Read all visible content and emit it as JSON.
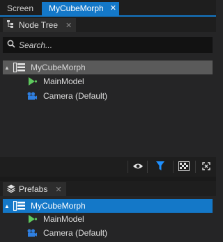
{
  "doc_tabs": {
    "screen": "Screen",
    "active": "MyCubeMorph",
    "close": "✕"
  },
  "node_tree": {
    "title": "Node Tree",
    "close": "✕",
    "search_placeholder": "Search...",
    "root": "MyCubeMorph",
    "children": [
      "MainModel",
      "Camera (Default)"
    ],
    "toolbar_icons": [
      "eye-icon",
      "filter-icon",
      "checkerboard-icon",
      "frame-icon"
    ],
    "filter_color": "#1e90ff"
  },
  "prefabs": {
    "title": "Prefabs",
    "close": "✕",
    "root": "MyCubeMorph",
    "children": [
      "MainModel",
      "Camera (Default)"
    ]
  },
  "colors": {
    "accent": "#1478c8",
    "node_green": "#5ec85e",
    "camera_blue": "#2f7fe0"
  }
}
